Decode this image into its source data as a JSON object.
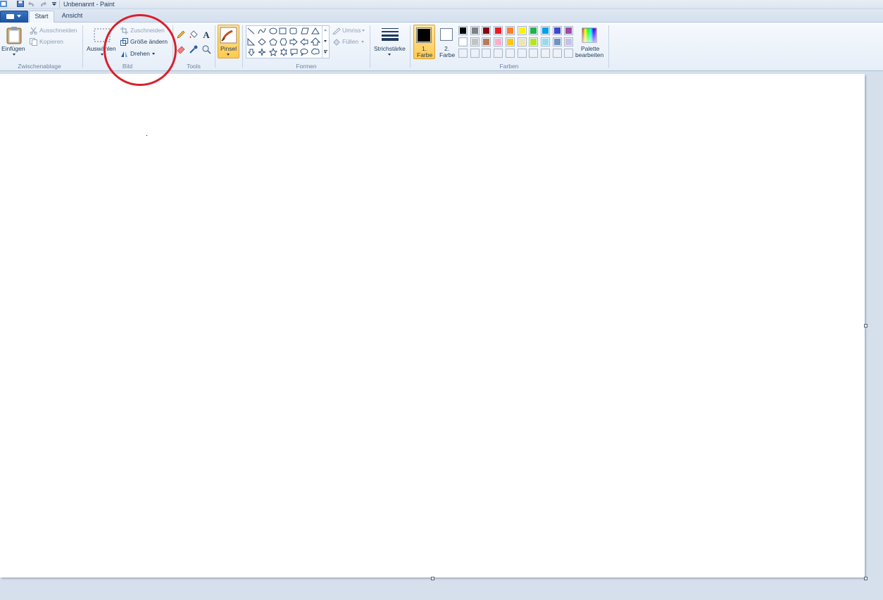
{
  "window": {
    "title": "Unbenannt - Paint"
  },
  "tabs": [
    {
      "label": "Start"
    },
    {
      "label": "Ansicht"
    }
  ],
  "clipboard": {
    "paste_label": "Einfügen",
    "cut_label": "Ausschneiden",
    "copy_label": "Kopieren",
    "group_label": "Zwischenablage"
  },
  "image": {
    "select_label": "Auswählen",
    "crop_label": "Zuschneiden",
    "resize_label": "Größe ändern",
    "rotate_label": "Drehen",
    "group_label": "Bild"
  },
  "tools": {
    "group_label": "Tools"
  },
  "brushes": {
    "label": "Pinsel"
  },
  "shapes": {
    "outline_label": "Umriss",
    "fill_label": "Füllen",
    "group_label": "Formen"
  },
  "stroke": {
    "label": "Strichstärke"
  },
  "colors": {
    "color1_label_a": "1.",
    "color1_label_b": "Farbe",
    "color2_label_a": "2.",
    "color2_label_b": "Farbe",
    "color1": "#000000",
    "color2": "#ffffff",
    "edit_label_a": "Palette",
    "edit_label_b": "bearbeiten",
    "group_label": "Farben",
    "palette_row1": [
      "#000000",
      "#7f7f7f",
      "#880015",
      "#ed1c24",
      "#ff7f27",
      "#fff200",
      "#22b14c",
      "#00a2e8",
      "#3f48cc",
      "#a349a4"
    ],
    "palette_row2": [
      "#ffffff",
      "#c3c3c3",
      "#b97a57",
      "#ffaec9",
      "#ffc90e",
      "#efe4b0",
      "#b5e61d",
      "#99d9ea",
      "#7092be",
      "#c8bfe7"
    ]
  },
  "annotation": {
    "color": "#d9202a"
  }
}
